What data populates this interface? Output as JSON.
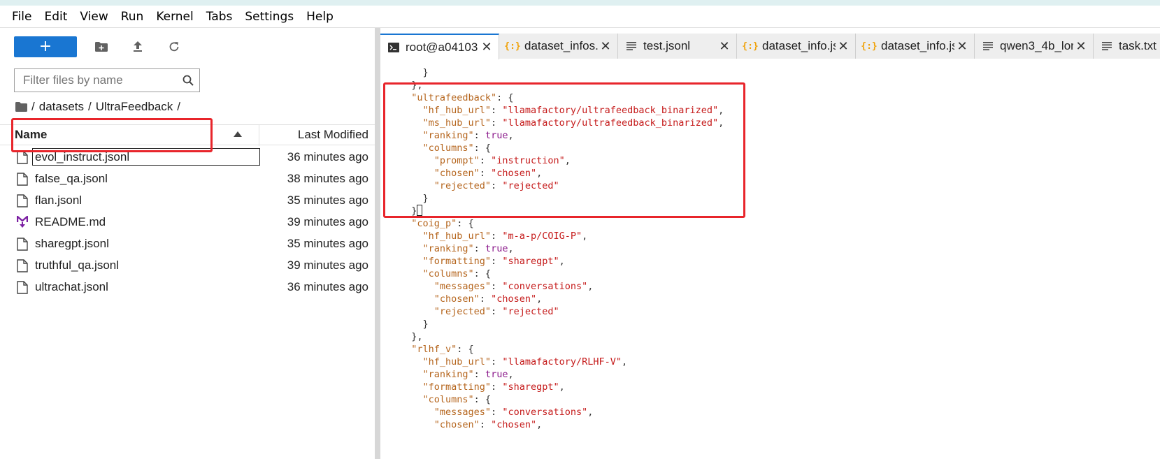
{
  "menubar": [
    "File",
    "Edit",
    "View",
    "Run",
    "Kernel",
    "Tabs",
    "Settings",
    "Help"
  ],
  "filebrowser": {
    "new_label": "+",
    "filter_placeholder": "Filter files by name",
    "breadcrumb": [
      "/",
      "datasets",
      "/",
      "UltraFeedback",
      "/"
    ],
    "header": {
      "name": "Name",
      "modified": "Last Modified"
    },
    "files": [
      {
        "name": "evol_instruct.jsonl",
        "modified": "36 minutes ago",
        "icon": "file-icon"
      },
      {
        "name": "false_qa.jsonl",
        "modified": "38 minutes ago",
        "icon": "file-icon"
      },
      {
        "name": "flan.jsonl",
        "modified": "35 minutes ago",
        "icon": "file-icon"
      },
      {
        "name": "README.md",
        "modified": "39 minutes ago",
        "icon": "markdown-icon"
      },
      {
        "name": "sharegpt.jsonl",
        "modified": "35 minutes ago",
        "icon": "file-icon"
      },
      {
        "name": "truthful_qa.jsonl",
        "modified": "39 minutes ago",
        "icon": "file-icon"
      },
      {
        "name": "ultrachat.jsonl",
        "modified": "36 minutes ago",
        "icon": "file-icon"
      }
    ]
  },
  "tabs": [
    {
      "label": "root@a04103",
      "icon": "terminal-icon",
      "active": true
    },
    {
      "label": "dataset_infos.",
      "icon": "json-icon",
      "active": false
    },
    {
      "label": "test.jsonl",
      "icon": "text-file-icon",
      "active": false
    },
    {
      "label": "dataset_info.js",
      "icon": "json-icon",
      "active": false
    },
    {
      "label": "dataset_info.js",
      "icon": "json-icon",
      "active": false
    },
    {
      "label": "qwen3_4b_lor",
      "icon": "text-file-icon",
      "active": false
    },
    {
      "label": "task.txt",
      "icon": "text-file-icon",
      "active": false
    }
  ],
  "code_lines": [
    [
      [
        "p",
        "    }"
      ]
    ],
    [
      [
        "p",
        "  },"
      ]
    ],
    [
      [
        "k",
        "  \"ultrafeedback\""
      ],
      [
        "p",
        ": {"
      ]
    ],
    [
      [
        "k",
        "    \"hf_hub_url\""
      ],
      [
        "p",
        ": "
      ],
      [
        "s",
        "\"llamafactory/ultrafeedback_binarized\""
      ],
      [
        "p",
        ","
      ]
    ],
    [
      [
        "k",
        "    \"ms_hub_url\""
      ],
      [
        "p",
        ": "
      ],
      [
        "s",
        "\"llamafactory/ultrafeedback_binarized\""
      ],
      [
        "p",
        ","
      ]
    ],
    [
      [
        "k",
        "    \"ranking\""
      ],
      [
        "p",
        ": "
      ],
      [
        "b",
        "true"
      ],
      [
        "p",
        ","
      ]
    ],
    [
      [
        "k",
        "    \"columns\""
      ],
      [
        "p",
        ": {"
      ]
    ],
    [
      [
        "k",
        "      \"prompt\""
      ],
      [
        "p",
        ": "
      ],
      [
        "s",
        "\"instruction\""
      ],
      [
        "p",
        ","
      ]
    ],
    [
      [
        "k",
        "      \"chosen\""
      ],
      [
        "p",
        ": "
      ],
      [
        "s",
        "\"chosen\""
      ],
      [
        "p",
        ","
      ]
    ],
    [
      [
        "k",
        "      \"rejected\""
      ],
      [
        "p",
        ": "
      ],
      [
        "s",
        "\"rejected\""
      ]
    ],
    [
      [
        "p",
        "    }"
      ]
    ],
    [
      [
        "p",
        "  }"
      ],
      [
        "cursor",
        ""
      ]
    ],
    [
      [
        "k",
        "  \"coig_p\""
      ],
      [
        "p",
        ": {"
      ]
    ],
    [
      [
        "k",
        "    \"hf_hub_url\""
      ],
      [
        "p",
        ": "
      ],
      [
        "s",
        "\"m-a-p/COIG-P\""
      ],
      [
        "p",
        ","
      ]
    ],
    [
      [
        "k",
        "    \"ranking\""
      ],
      [
        "p",
        ": "
      ],
      [
        "b",
        "true"
      ],
      [
        "p",
        ","
      ]
    ],
    [
      [
        "k",
        "    \"formatting\""
      ],
      [
        "p",
        ": "
      ],
      [
        "s",
        "\"sharegpt\""
      ],
      [
        "p",
        ","
      ]
    ],
    [
      [
        "k",
        "    \"columns\""
      ],
      [
        "p",
        ": {"
      ]
    ],
    [
      [
        "k",
        "      \"messages\""
      ],
      [
        "p",
        ": "
      ],
      [
        "s",
        "\"conversations\""
      ],
      [
        "p",
        ","
      ]
    ],
    [
      [
        "k",
        "      \"chosen\""
      ],
      [
        "p",
        ": "
      ],
      [
        "s",
        "\"chosen\""
      ],
      [
        "p",
        ","
      ]
    ],
    [
      [
        "k",
        "      \"rejected\""
      ],
      [
        "p",
        ": "
      ],
      [
        "s",
        "\"rejected\""
      ]
    ],
    [
      [
        "p",
        "    }"
      ]
    ],
    [
      [
        "p",
        "  },"
      ]
    ],
    [
      [
        "k",
        "  \"rlhf_v\""
      ],
      [
        "p",
        ": {"
      ]
    ],
    [
      [
        "k",
        "    \"hf_hub_url\""
      ],
      [
        "p",
        ": "
      ],
      [
        "s",
        "\"llamafactory/RLHF-V\""
      ],
      [
        "p",
        ","
      ]
    ],
    [
      [
        "k",
        "    \"ranking\""
      ],
      [
        "p",
        ": "
      ],
      [
        "b",
        "true"
      ],
      [
        "p",
        ","
      ]
    ],
    [
      [
        "k",
        "    \"formatting\""
      ],
      [
        "p",
        ": "
      ],
      [
        "s",
        "\"sharegpt\""
      ],
      [
        "p",
        ","
      ]
    ],
    [
      [
        "k",
        "    \"columns\""
      ],
      [
        "p",
        ": {"
      ]
    ],
    [
      [
        "k",
        "      \"messages\""
      ],
      [
        "p",
        ": "
      ],
      [
        "s",
        "\"conversations\""
      ],
      [
        "p",
        ","
      ]
    ],
    [
      [
        "k",
        "      \"chosen\""
      ],
      [
        "p",
        ": "
      ],
      [
        "s",
        "\"chosen\""
      ],
      [
        "p",
        ","
      ]
    ]
  ],
  "colors": {
    "accent": "#1976d2",
    "highlight": "#e8252b",
    "json_key": "#b5651d",
    "json_string": "#c51a1a",
    "json_bool": "#8b1a8b"
  }
}
